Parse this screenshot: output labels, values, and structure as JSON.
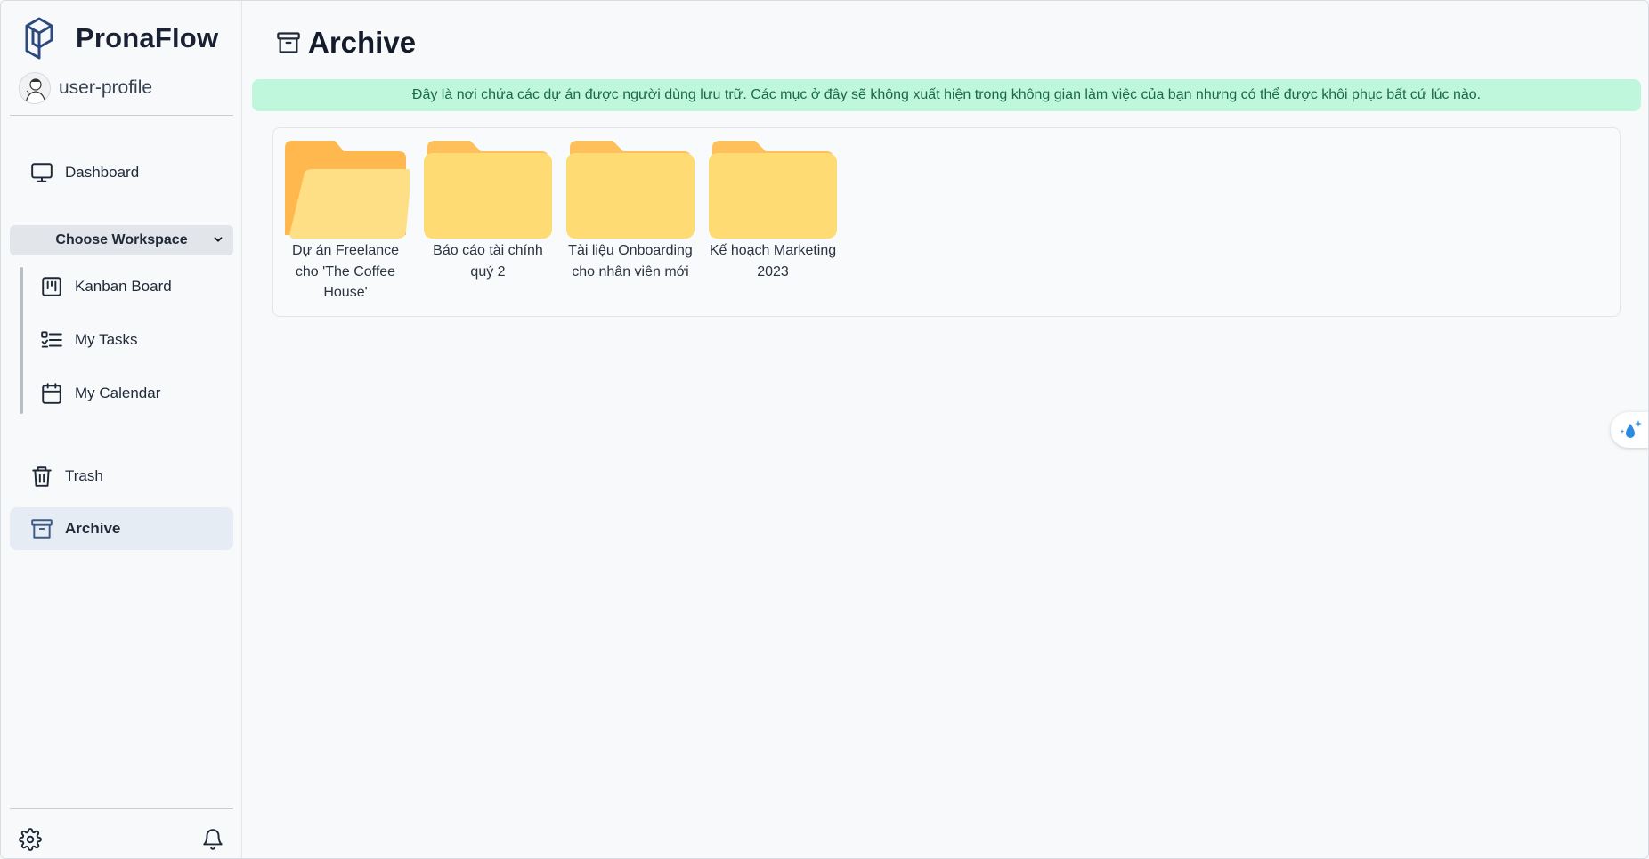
{
  "app": {
    "brand": "PronaFlow",
    "user": "user-profile"
  },
  "sidebar": {
    "dashboard_label": "Dashboard",
    "workspace_select": "Choose Workspace",
    "workspace_items": [
      {
        "label": "Kanban Board",
        "icon": "kanban-icon"
      },
      {
        "label": "My Tasks",
        "icon": "task-list-icon"
      },
      {
        "label": "My Calendar",
        "icon": "calendar-icon"
      }
    ],
    "trash_label": "Trash",
    "archive_label": "Archive",
    "active": "Archive"
  },
  "page": {
    "title": "Archive",
    "notice": "Đây là nơi chứa các dự án được người dùng lưu trữ. Các mục ở đây sẽ không xuất hiện trong không gian làm việc của bạn nhưng có thể được khôi phục bất cứ lúc nào."
  },
  "folders": [
    {
      "name": "Dự án Freelance cho 'The Coffee House'",
      "state": "open"
    },
    {
      "name": "Báo cáo tài chính quý 2",
      "state": "closed"
    },
    {
      "name": "Tài liệu Onboarding cho nhân viên mới",
      "state": "closed"
    },
    {
      "name": "Kế hoạch Marketing 2023",
      "state": "closed"
    }
  ],
  "colors": {
    "notice_bg": "#bff7dc",
    "folder_front": "#ffdb74",
    "folder_back": "#ffb84d",
    "active_bg": "#e6ecf3"
  }
}
